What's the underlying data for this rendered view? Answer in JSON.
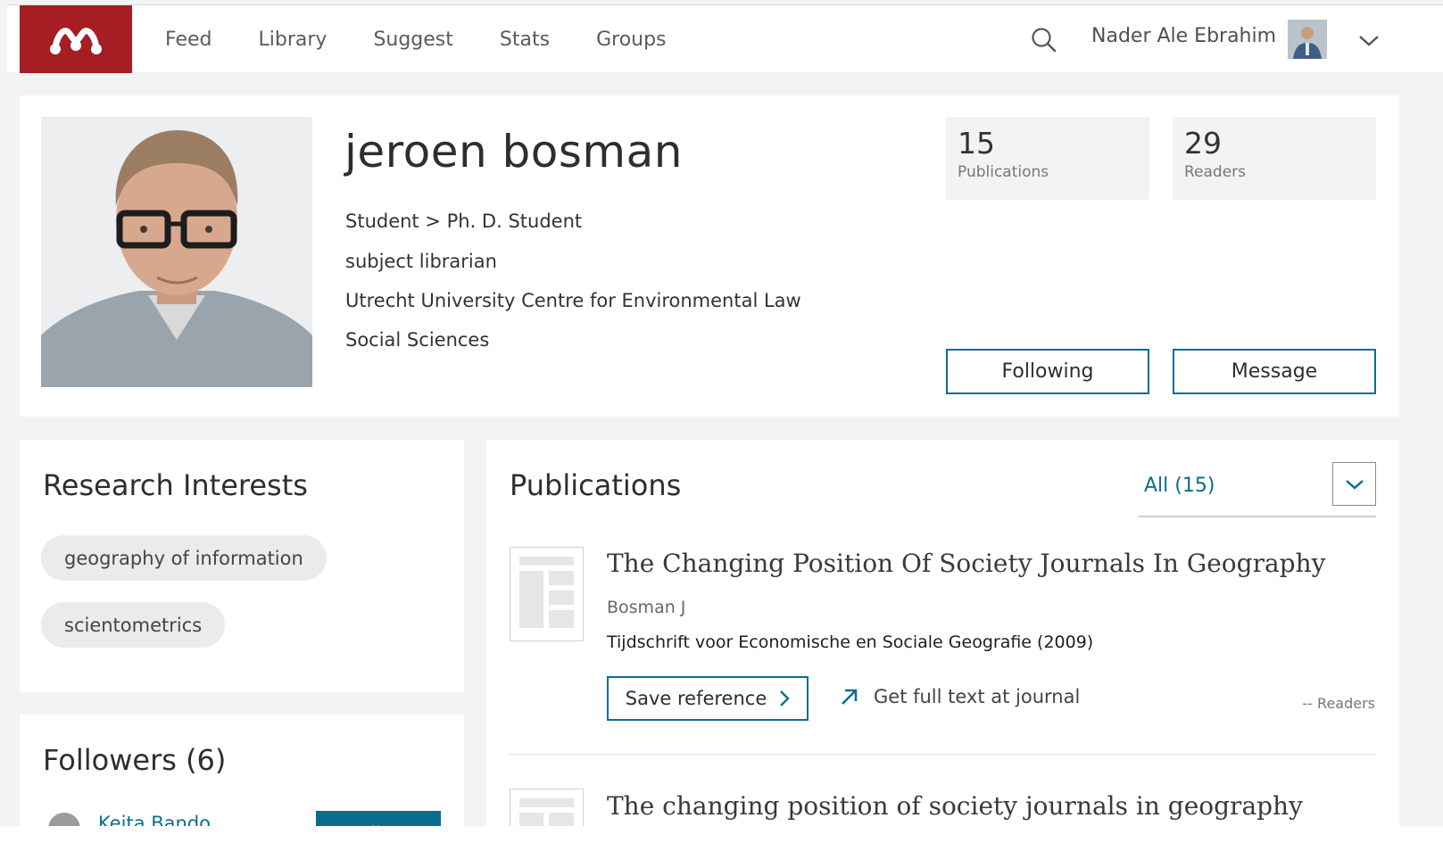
{
  "nav": {
    "items": [
      "Feed",
      "Library",
      "Suggest",
      "Stats",
      "Groups"
    ],
    "user_name": "Nader Ale Ebrahim",
    "icons": {
      "search": "search-icon",
      "menu": "chevron-down-icon",
      "logo": "mendeley-logo"
    }
  },
  "profile": {
    "name": "jeroen bosman",
    "status": "Student > Ph. D. Student",
    "position": "subject librarian",
    "institution": "Utrecht University Centre for Environmental Law",
    "discipline": "Social Sciences",
    "stats": {
      "publications_value": "15",
      "publications_label": "Publications",
      "readers_value": "29",
      "readers_label": "Readers"
    },
    "following_label": "Following",
    "message_label": "Message"
  },
  "interests": {
    "title": "Research Interests",
    "tags": [
      "geography of information",
      "scientometrics"
    ]
  },
  "followers": {
    "title": "Followers (6)",
    "first_name": "Keita Bando",
    "follow_label": "Follow"
  },
  "publications": {
    "title": "Publications",
    "filter_value": "All (15)",
    "items": [
      {
        "title": "The Changing Position Of Society Journals In Geography",
        "author": "Bosman J",
        "journal": "Tijdschrift voor Economische en Sociale Geografie (2009)",
        "save_label": "Save reference",
        "fulltext_label": "Get full text at journal",
        "readers": "-- Readers"
      },
      {
        "title": "The changing position of society journals in geography"
      }
    ]
  },
  "colors": {
    "brand": "#a61d24",
    "accent": "#0a6d8f",
    "background": "#f3f3f3"
  }
}
